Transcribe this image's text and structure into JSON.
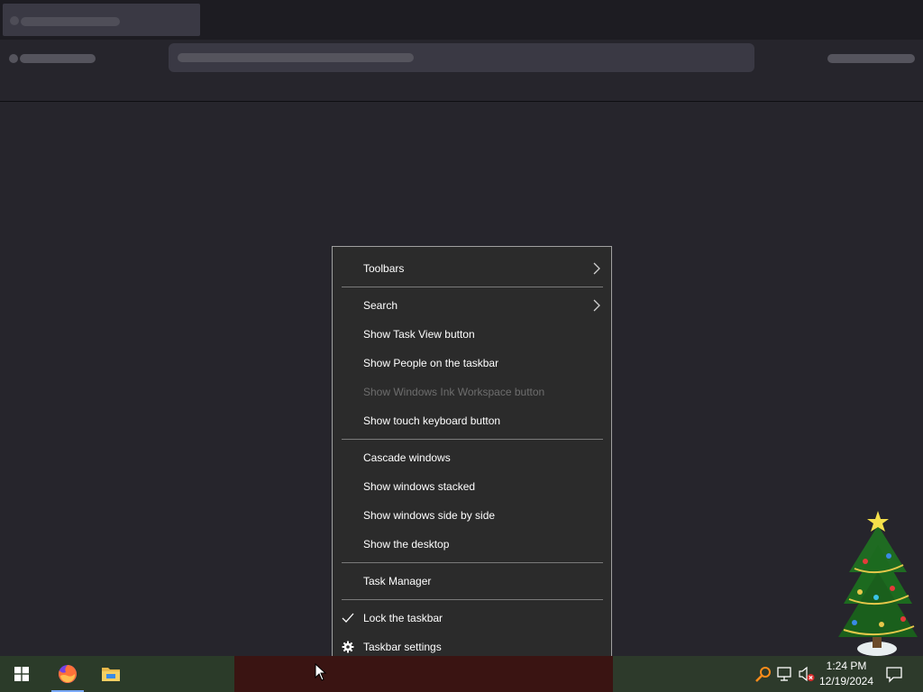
{
  "context_menu": {
    "items": [
      {
        "label": "Toolbars",
        "submenu": true,
        "enabled": true
      },
      {
        "label": "Search",
        "submenu": true,
        "enabled": true
      },
      {
        "label": "Show Task View button",
        "enabled": true
      },
      {
        "label": "Show People on the taskbar",
        "enabled": true
      },
      {
        "label": "Show Windows Ink Workspace button",
        "enabled": false
      },
      {
        "label": "Show touch keyboard button",
        "enabled": true
      },
      {
        "label": "Cascade windows",
        "enabled": true
      },
      {
        "label": "Show windows stacked",
        "enabled": true
      },
      {
        "label": "Show windows side by side",
        "enabled": true
      },
      {
        "label": "Show the desktop",
        "enabled": true
      },
      {
        "label": "Task Manager",
        "enabled": true
      },
      {
        "label": "Lock the taskbar",
        "checked": true,
        "enabled": true
      },
      {
        "label": "Taskbar settings",
        "icon": "gear-icon",
        "enabled": true
      }
    ]
  },
  "taskbar": {
    "pinned": [
      {
        "name": "start-button",
        "icon": "windows-logo-icon"
      },
      {
        "name": "firefox-button",
        "icon": "firefox-icon",
        "active": true
      },
      {
        "name": "file-explorer-button",
        "icon": "folder-icon"
      }
    ],
    "tray": {
      "icons": [
        "search-icon",
        "network-icon",
        "volume-muted-icon"
      ],
      "time": "1:24 PM",
      "date": "12/19/2024"
    }
  },
  "colors": {
    "menu_bg": "#2b2b2b",
    "menu_border": "#a0a0a0",
    "disabled_text": "#6d6d6d",
    "app_bg": "#26252c"
  }
}
